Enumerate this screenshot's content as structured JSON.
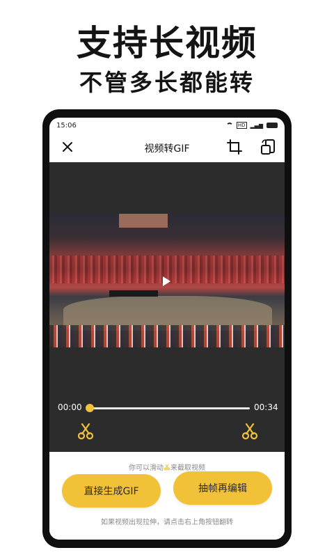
{
  "promo": {
    "title": "支持长视频",
    "subtitle": "不管多长都能转"
  },
  "status_bar": {
    "time": "15:06"
  },
  "app_bar": {
    "title": "视频转GIF"
  },
  "player": {
    "start_time": "00:00",
    "end_time": "00:34",
    "progress_fraction": 0.0
  },
  "panel": {
    "hint_top_before": "你可以滑动",
    "hint_top_after": "来截取视频",
    "generate_button": "直接生成GIF",
    "edit_button": "抽帧再编辑",
    "hint_bottom": "如果视频出现拉伸，请点击右上角按钮翻转"
  },
  "colors": {
    "accent": "#f1c238",
    "video_bg": "#2c2c2c"
  }
}
